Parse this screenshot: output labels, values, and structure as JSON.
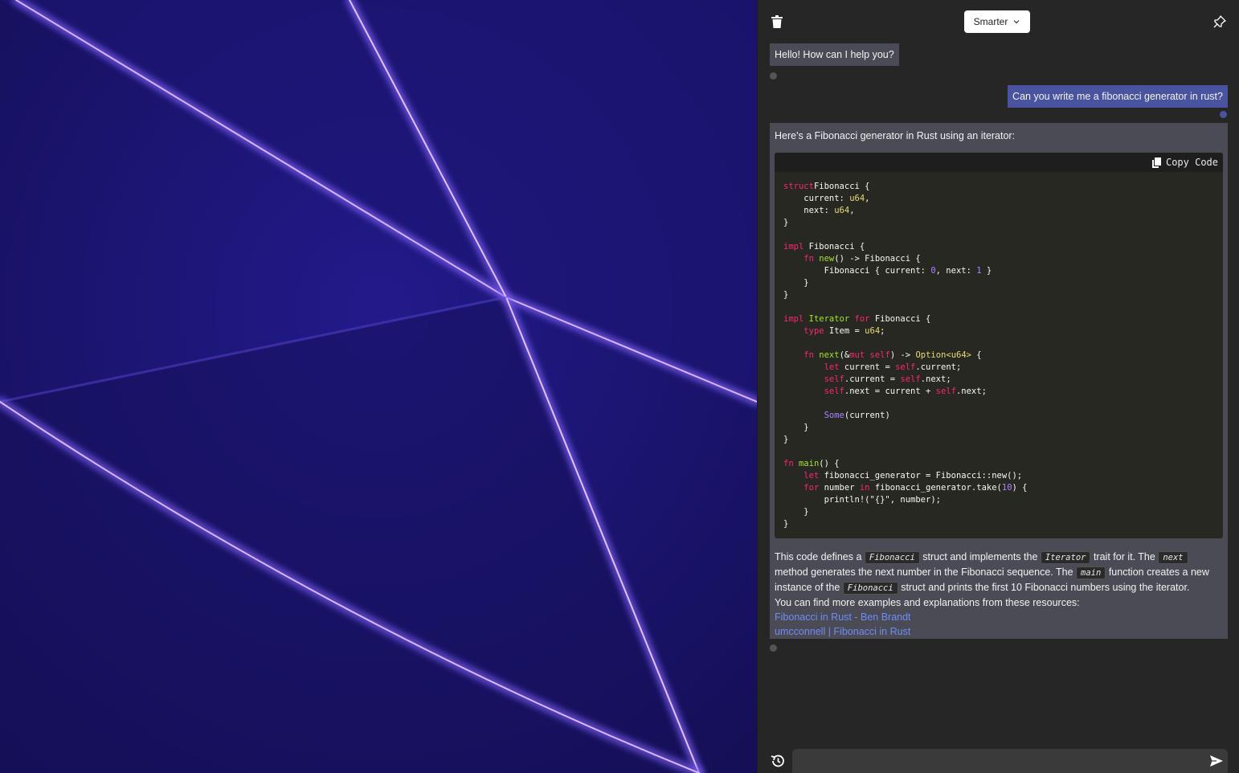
{
  "header": {
    "model_label": "Smarter",
    "icons": {
      "clear": "trash-icon",
      "pin": "pin-icon",
      "chevron": "chevron-down-icon"
    }
  },
  "messages": {
    "greeting": "Hello! How can I help you?",
    "user_question": "Can you write me a fibonacci generator in rust?",
    "answer_intro": "Here's a Fibonacci generator in Rust using an iterator:",
    "copy_label": "Copy Code",
    "explain": {
      "p1": "This code defines a",
      "c1": "Fibonacci",
      "p2": "struct and implements the",
      "c2": "Iterator",
      "p3": "trait for it. The",
      "c3": "next",
      "p4": "method generates the next number in the Fibonacci sequence. The",
      "c4": "main",
      "p5": "function creates a new instance of the",
      "c5": "Fibonacci",
      "p6": "struct and prints the first 10 Fibonacci numbers using the iterator.",
      "resources": "You can find more examples and explanations from these resources:",
      "link1": "Fibonacci in Rust - Ben Brandt",
      "link2": "umcconnell | Fibonacci in Rust"
    }
  },
  "code_lines": [
    [
      [
        "kw",
        "struct"
      ],
      [
        "",
        "Fibonacci {"
      ]
    ],
    [
      [
        "",
        "    current: "
      ],
      [
        "ty",
        "u64"
      ],
      [
        "",
        ","
      ]
    ],
    [
      [
        "",
        "    next: "
      ],
      [
        "ty",
        "u64"
      ],
      [
        "",
        ","
      ]
    ],
    [
      [
        "",
        "}"
      ]
    ],
    [],
    [
      [
        "kw",
        "impl"
      ],
      [
        "",
        " Fibonacci {"
      ]
    ],
    [
      [
        "",
        "    "
      ],
      [
        "kw",
        "fn"
      ],
      [
        "",
        " "
      ],
      [
        "fn",
        "new"
      ],
      [
        "",
        "() -> Fibonacci {"
      ]
    ],
    [
      [
        "",
        "        Fibonacci { current: "
      ],
      [
        "num",
        "0"
      ],
      [
        "",
        ", next: "
      ],
      [
        "num",
        "1"
      ],
      [
        "",
        " }"
      ]
    ],
    [
      [
        "",
        "    }"
      ]
    ],
    [
      [
        "",
        "}"
      ]
    ],
    [],
    [
      [
        "kw",
        "impl"
      ],
      [
        "",
        " "
      ],
      [
        "fn",
        "Iterator"
      ],
      [
        "",
        " "
      ],
      [
        "kw",
        "for"
      ],
      [
        "",
        " Fibonacci {"
      ]
    ],
    [
      [
        "",
        "    "
      ],
      [
        "kw",
        "type"
      ],
      [
        "",
        " Item = "
      ],
      [
        "ty",
        "u64"
      ],
      [
        "",
        ";"
      ]
    ],
    [],
    [
      [
        "",
        "    "
      ],
      [
        "kw",
        "fn"
      ],
      [
        "",
        " "
      ],
      [
        "fn",
        "next"
      ],
      [
        "",
        "(&"
      ],
      [
        "kw",
        "mut"
      ],
      [
        "",
        " "
      ],
      [
        "sf",
        "self"
      ],
      [
        "",
        ") -> "
      ],
      [
        "ty",
        "Option<u64>"
      ],
      [
        "",
        " {"
      ]
    ],
    [
      [
        "",
        "        "
      ],
      [
        "kw",
        "let"
      ],
      [
        "",
        " current = "
      ],
      [
        "sf",
        "self"
      ],
      [
        "",
        ".current;"
      ]
    ],
    [
      [
        "",
        "        "
      ],
      [
        "sf",
        "self"
      ],
      [
        "",
        ".current = "
      ],
      [
        "sf",
        "self"
      ],
      [
        "",
        ".next;"
      ]
    ],
    [
      [
        "",
        "        "
      ],
      [
        "sf",
        "self"
      ],
      [
        "",
        ".next = current + "
      ],
      [
        "sf",
        "self"
      ],
      [
        "",
        ".next;"
      ]
    ],
    [],
    [
      [
        "",
        "        "
      ],
      [
        "some",
        "Some"
      ],
      [
        "",
        "(current)"
      ]
    ],
    [
      [
        "",
        "    }"
      ]
    ],
    [
      [
        "",
        "}"
      ]
    ],
    [],
    [
      [
        "kw",
        "fn"
      ],
      [
        "",
        " "
      ],
      [
        "fn",
        "main"
      ],
      [
        "",
        "() {"
      ]
    ],
    [
      [
        "",
        "    "
      ],
      [
        "kw",
        "let"
      ],
      [
        "",
        " fibonacci_generator = Fibonacci::new();"
      ]
    ],
    [
      [
        "",
        "    "
      ],
      [
        "kw",
        "for"
      ],
      [
        "",
        " number "
      ],
      [
        "kw",
        "in"
      ],
      [
        "",
        " fibonacci_generator.take("
      ],
      [
        "num",
        "10"
      ],
      [
        "",
        ") {"
      ]
    ],
    [
      [
        "",
        "        println!(\"{}\", number);"
      ]
    ],
    [
      [
        "",
        "    }"
      ]
    ],
    [
      [
        "",
        "}"
      ]
    ]
  ],
  "input": {
    "value": "",
    "placeholder": ""
  },
  "footer_icons": {
    "history": "history-icon",
    "send": "send-icon"
  }
}
